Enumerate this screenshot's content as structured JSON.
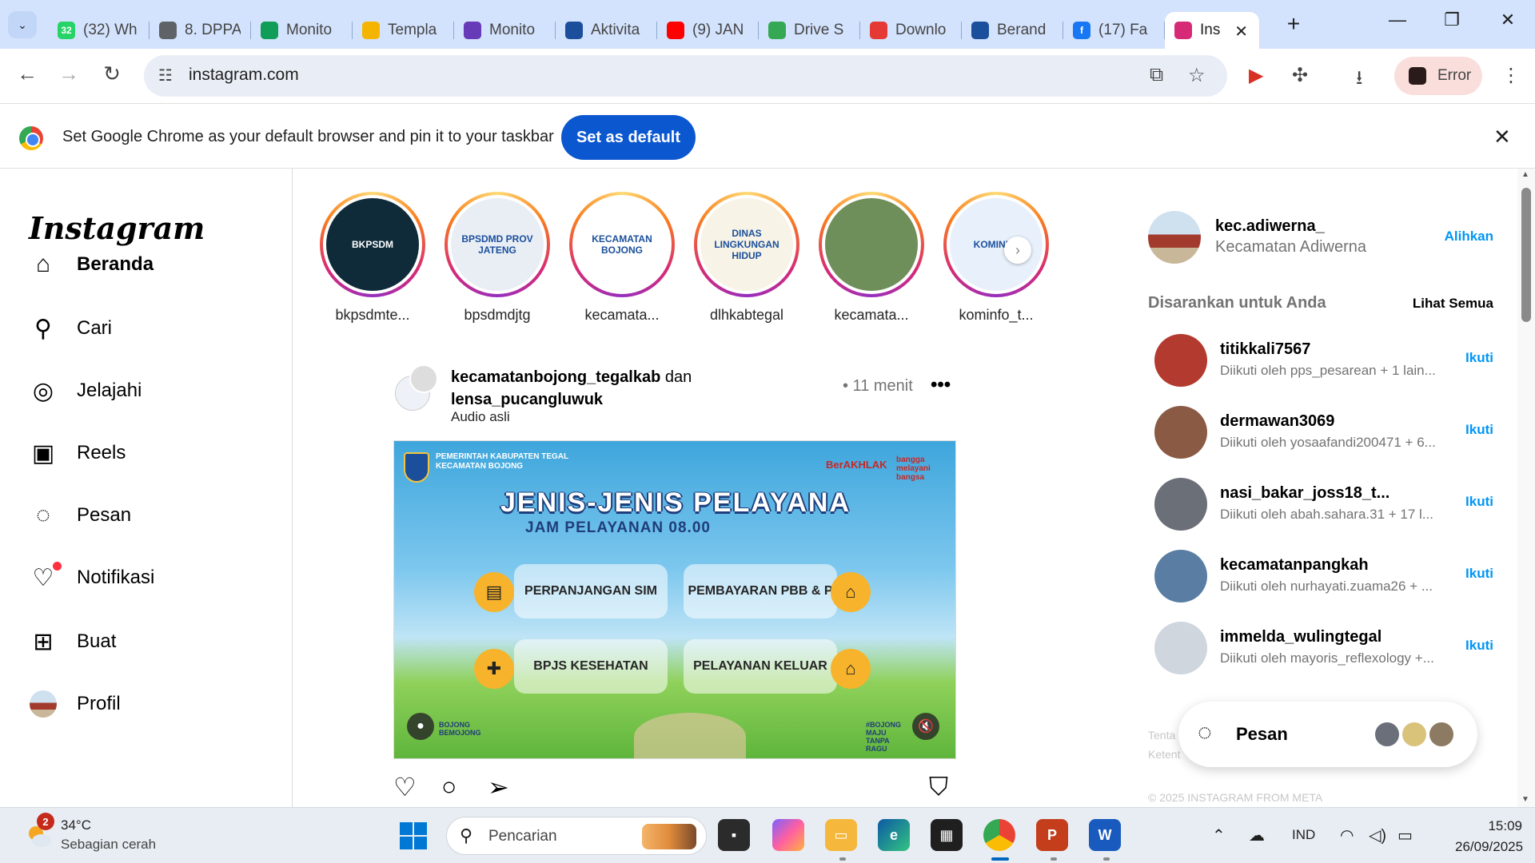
{
  "browser": {
    "tabs": [
      {
        "label": "(32) Wh",
        "fav_color": "#25d366",
        "fav_text": "32"
      },
      {
        "label": "8. DPPA",
        "fav_color": "#5f6368",
        "fav_text": ""
      },
      {
        "label": "Monito",
        "fav_color": "#0f9d58",
        "fav_text": ""
      },
      {
        "label": "Templa",
        "fav_color": "#f4b400",
        "fav_text": ""
      },
      {
        "label": "Monito",
        "fav_color": "#673ab7",
        "fav_text": ""
      },
      {
        "label": "Aktivita",
        "fav_color": "#1b4f9c",
        "fav_text": ""
      },
      {
        "label": "(9) JAN",
        "fav_color": "#ff0000",
        "fav_text": ""
      },
      {
        "label": "Drive S",
        "fav_color": "#34a853",
        "fav_text": ""
      },
      {
        "label": "Downlo",
        "fav_color": "#e53935",
        "fav_text": ""
      },
      {
        "label": "Berand",
        "fav_color": "#1b4f9c",
        "fav_text": ""
      },
      {
        "label": "(17) Fa",
        "fav_color": "#1877f2",
        "fav_text": "f"
      }
    ],
    "active_tab": {
      "label": "Ins",
      "fav_color": "#d62976"
    },
    "url": "instagram.com",
    "profile_label": "Error"
  },
  "infobar": {
    "message": "Set Google Chrome as your default browser and pin it to your taskbar",
    "button": "Set as default"
  },
  "sidebar": {
    "logo": "Instagram",
    "items": [
      {
        "label": "Beranda",
        "icon": "home-icon",
        "glyph": "⌂"
      },
      {
        "label": "Cari",
        "icon": "search-icon",
        "glyph": "⚲"
      },
      {
        "label": "Jelajahi",
        "icon": "compass-icon",
        "glyph": "◎"
      },
      {
        "label": "Reels",
        "icon": "reels-icon",
        "glyph": "▣"
      },
      {
        "label": "Pesan",
        "icon": "messenger-icon",
        "glyph": "◌"
      },
      {
        "label": "Notifikasi",
        "icon": "heart-icon",
        "glyph": "♡"
      },
      {
        "label": "Buat",
        "icon": "plus-square-icon",
        "glyph": "⊞"
      },
      {
        "label": "Profil",
        "icon": "profile-avatar-icon",
        "glyph": ""
      }
    ]
  },
  "stories": [
    {
      "name": "bkpsdmte...",
      "pic_color": "#0f2b3a",
      "pic_text": "BKPSDM"
    },
    {
      "name": "bpsdmdjtg",
      "pic_color": "#e9eef5",
      "pic_text": "BPSDMD PROV JATENG"
    },
    {
      "name": "kecamata...",
      "pic_color": "#ffffff",
      "pic_text": "KECAMATAN BOJONG"
    },
    {
      "name": "dlhkabtegal",
      "pic_color": "#f7f3e6",
      "pic_text": "DINAS LINGKUNGAN HIDUP"
    },
    {
      "name": "kecamata...",
      "pic_color": "#6f8f5a",
      "pic_text": ""
    },
    {
      "name": "kominfo_t...",
      "pic_color": "#e8f1fb",
      "pic_text": "KOMINFO"
    }
  ],
  "post": {
    "author": "kecamatanbojong_tegalkab",
    "connector": "dan",
    "coauthor": "lensa_pucangluwuk",
    "audio": "Audio asli",
    "time": "• 11 menit",
    "image": {
      "gov_line1": "PEMERINTAH KABUPATEN TEGAL",
      "gov_line2": "KECAMATAN BOJONG",
      "berakhlak": "BerAKHLAK",
      "bangga": "bangga melayani bangsa",
      "title": "JENIS-JENIS PELAYANA",
      "subtitle": "JAM PELAYANAN 08.00",
      "cards": [
        "PERPANJANGAN SIM",
        "PEMBAYARAN PBB & P",
        "BPJS KESEHATAN",
        "PELAYANAN KELUAR"
      ],
      "bottom_left": "BOJONG BEMOJONG",
      "bottom_right": "#BOJONG MAJU TANPA RAGU"
    }
  },
  "account": {
    "username": "kec.adiwerna_",
    "fullname": "Kecamatan Adiwerna",
    "switch": "Alihkan"
  },
  "suggestions": {
    "heading": "Disarankan untuk Anda",
    "see_all": "Lihat Semua",
    "follow_label": "Ikuti",
    "items": [
      {
        "name": "titikkali7567",
        "sub": "Diikuti oleh pps_pesarean + 1 lain...",
        "color": "#b23a2e"
      },
      {
        "name": "dermawan3069",
        "sub": "Diikuti oleh yosaafandi200471 + 6...",
        "color": "#8a5a44"
      },
      {
        "name": "nasi_bakar_joss18_t...",
        "sub": "Diikuti oleh abah.sahara.31 + 17 l...",
        "color": "#6b6f78"
      },
      {
        "name": "kecamatanpangkah",
        "sub": "Diikuti oleh nurhayati.zuama26 + ...",
        "color": "#5a7ea3"
      },
      {
        "name": "immelda_wulingtegal",
        "sub": "Diikuti oleh mayoris_reflexology +...",
        "color": "#cfd6de"
      }
    ],
    "footer_links": [
      "Tenta",
      "Ketent"
    ],
    "copyright": "© 2025 INSTAGRAM FROM META"
  },
  "messages_pill": {
    "label": "Pesan"
  },
  "taskbar": {
    "weather_badge": "2",
    "temperature": "34°C",
    "condition": "Sebagian cerah",
    "search_placeholder": "Pencarian",
    "language": "IND",
    "time": "15:09",
    "date": "26/09/2025"
  }
}
